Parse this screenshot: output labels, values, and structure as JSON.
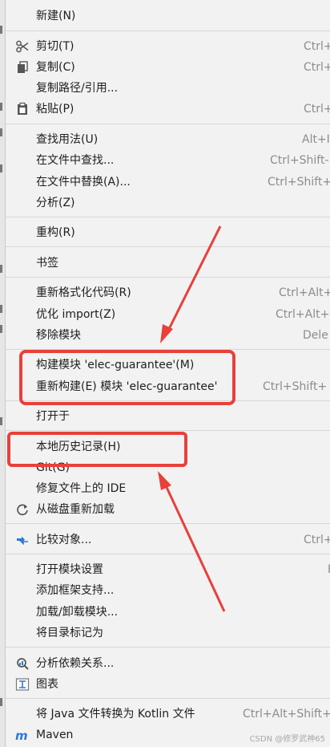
{
  "menu": {
    "new": {
      "label": "新建(N)"
    },
    "cut": {
      "label": "剪切(T)",
      "shortcut": "Ctrl+"
    },
    "copy": {
      "label": "复制(C)",
      "shortcut": "Ctrl+"
    },
    "copy_path": {
      "label": "复制路径/引用..."
    },
    "paste": {
      "label": "粘贴(P)",
      "shortcut": "Ctrl+"
    },
    "find_usages": {
      "label": "查找用法(U)",
      "shortcut": "Alt+I"
    },
    "find_in_files": {
      "label": "在文件中查找...",
      "shortcut": "Ctrl+Shift-"
    },
    "replace_in_files": {
      "label": "在文件中替换(A)...",
      "shortcut": "Ctrl+Shift+"
    },
    "analyze": {
      "label": "分析(Z)"
    },
    "refactor": {
      "label": "重构(R)"
    },
    "bookmarks": {
      "label": "书签"
    },
    "reformat": {
      "label": "重新格式化代码(R)",
      "shortcut": "Ctrl+Alt+"
    },
    "optimize_imports": {
      "label": "优化 import(Z)",
      "shortcut": "Ctrl+Alt+"
    },
    "remove_module": {
      "label": "移除模块",
      "shortcut": "Dele"
    },
    "build_module": {
      "label": "构建模块 'elec-guarantee'(M)"
    },
    "rebuild_module": {
      "label": "重新构建(E) 模块 'elec-guarantee'",
      "shortcut": "Ctrl+Shift+"
    },
    "open_in": {
      "label": "打开于"
    },
    "local_history": {
      "label": "本地历史记录(H)"
    },
    "git": {
      "label": "Git(G)"
    },
    "fix_ide": {
      "label": "修复文件上的 IDE"
    },
    "reload_disk": {
      "label": "从磁盘重新加载"
    },
    "compare": {
      "label": "比较对象...",
      "shortcut": "Ctrl+"
    },
    "module_settings": {
      "label": "打开模块设置",
      "shortcut": "F"
    },
    "add_framework": {
      "label": "添加框架支持..."
    },
    "load_modules": {
      "label": "加载/卸载模块..."
    },
    "mark_directory": {
      "label": "将目录标记为"
    },
    "analyze_deps": {
      "label": "分析依赖关系..."
    },
    "diagrams": {
      "label": "图表"
    },
    "convert_kotlin": {
      "label": "将 Java 文件转换为 Kotlin 文件",
      "shortcut": "Ctrl+Alt+Shift+"
    },
    "maven": {
      "label": "Maven"
    }
  },
  "colors": {
    "annotation": "#e8403a",
    "maven_icon": "#2a7ad8",
    "compare_icon": "#2f79d3"
  },
  "watermark": "CSDN @修罗武神65"
}
